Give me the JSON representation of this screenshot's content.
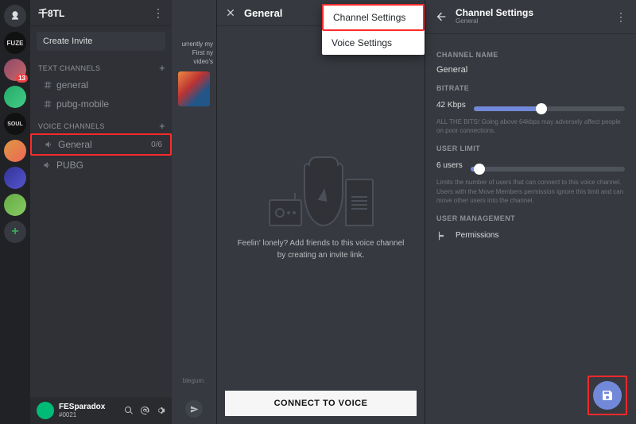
{
  "serverPill": {
    "fuze": "FUZE",
    "soul": "SOUL",
    "badge": "13"
  },
  "serverHeader": {
    "name": "千8TL"
  },
  "createInvite": "Create Invite",
  "sections": {
    "text": "TEXT CHANNELS",
    "voice": "VOICE CHANNELS"
  },
  "textChannels": [
    {
      "name": "general"
    },
    {
      "name": "pubg-mobile"
    }
  ],
  "voiceChannels": [
    {
      "name": "General",
      "count": "0/6"
    },
    {
      "name": "PUBG"
    }
  ],
  "user": {
    "name": "FESparadox",
    "tag": "#0021"
  },
  "peek": {
    "text": "urrently\nmy First\nny video's",
    "bottom": "blegum."
  },
  "voicePanel": {
    "title": "General",
    "lonely": "Feelin' lonely? Add friends to this voice channel by creating an invite link.",
    "connect": "CONNECT TO VOICE"
  },
  "menu": {
    "channel": "Channel Settings",
    "voice": "Voice Settings"
  },
  "settings": {
    "title": "Channel Settings",
    "sub": "General",
    "channelNameLabel": "CHANNEL NAME",
    "channelName": "General",
    "bitrateLabel": "BITRATE",
    "bitrateValue": "42 Kbps",
    "bitrateHelp": "ALL THE BITS! Going above 64kbps may adversely affect people on poor connections.",
    "userLimitLabel": "USER LIMIT",
    "userLimitValue": "6 users",
    "userLimitHelp": "Limits the number of users that can connect to this voice channel. Users with the Move Members permission ignore this limit and can move other users into the channel.",
    "userMgmtLabel": "USER MANAGEMENT",
    "permissions": "Permissions"
  }
}
